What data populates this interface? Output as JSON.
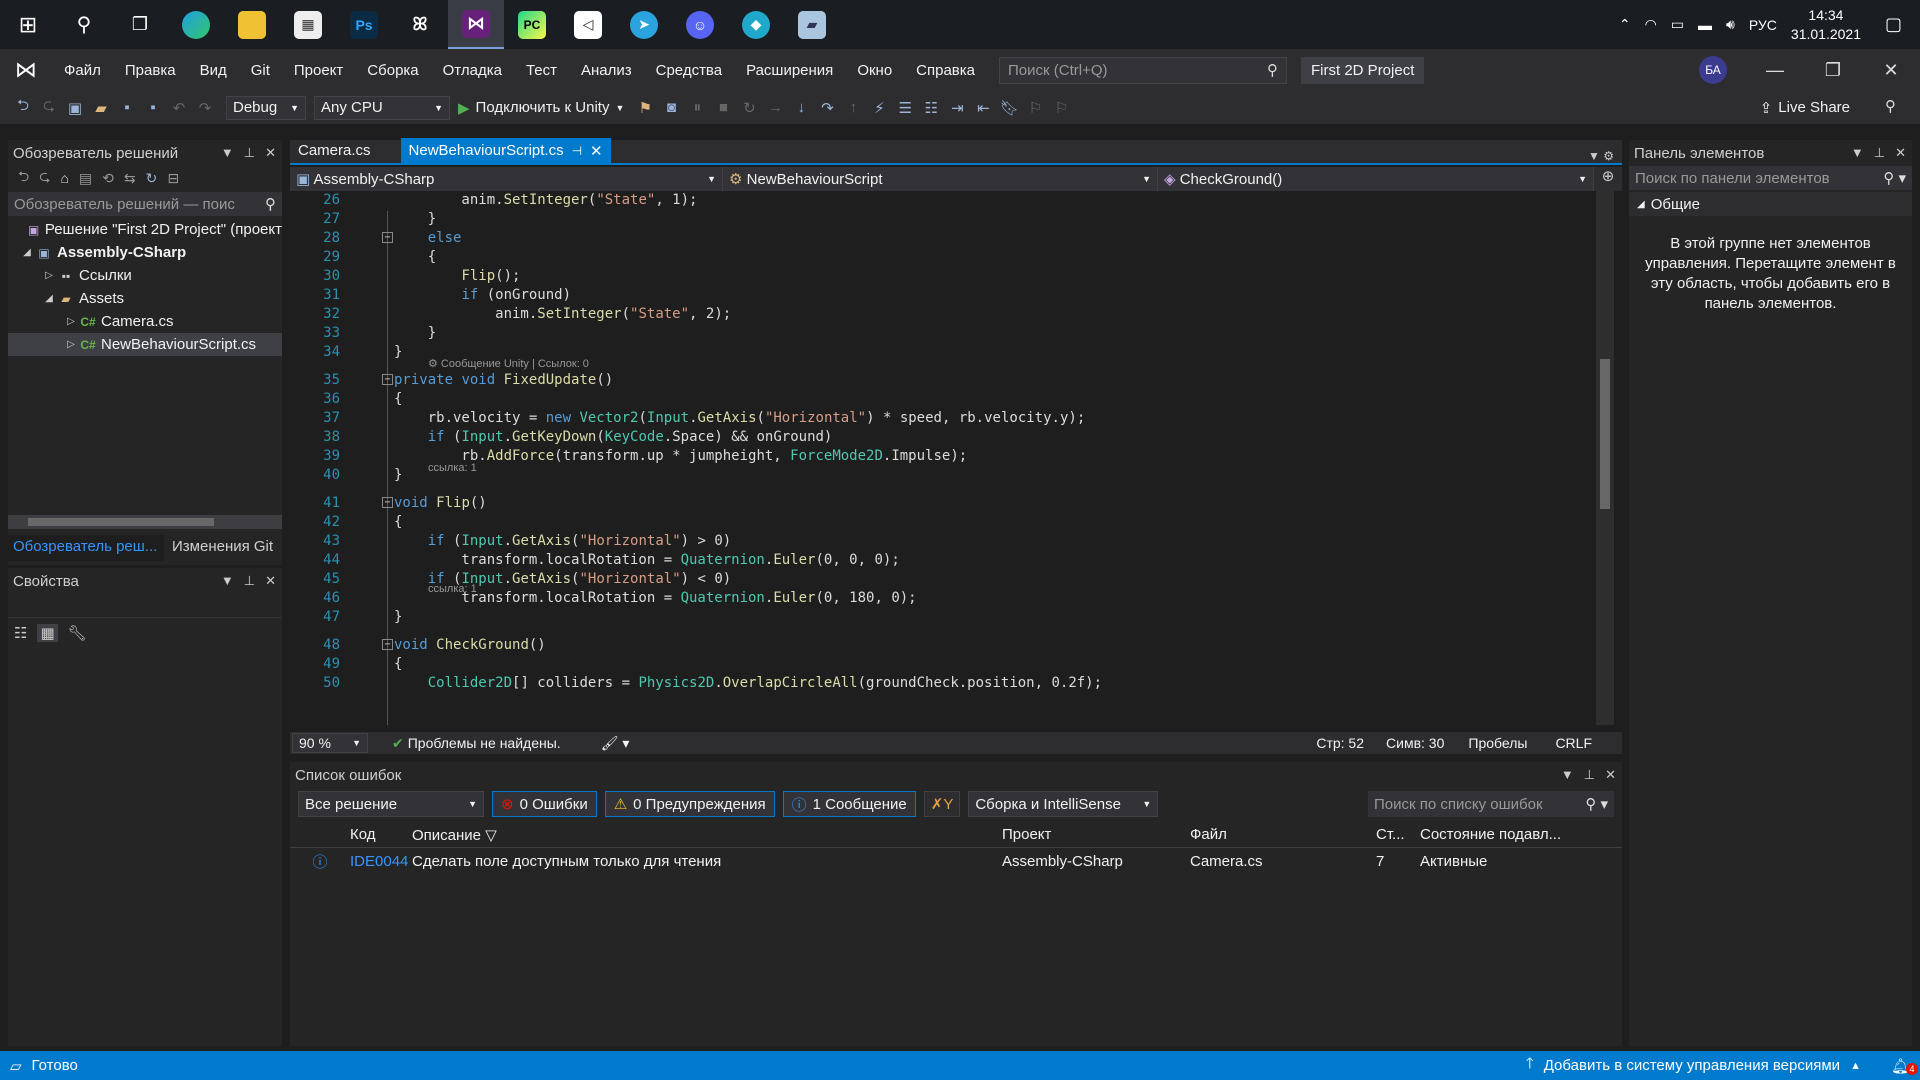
{
  "taskbar": {
    "icons": [
      "windows-start-icon",
      "search-icon",
      "task-view-icon",
      "edge-icon",
      "file-explorer-icon",
      "store-icon",
      "photoshop-icon",
      "unity-hub-icon",
      "visual-studio-icon",
      "pycharm-icon",
      "unity-icon",
      "telegram-icon",
      "discord-icon",
      "app-icon",
      "app2-icon"
    ],
    "ps_label": "Ps",
    "pc_label": "PC",
    "lang": "РУС",
    "time": "14:34",
    "date": "31.01.2021"
  },
  "menu": {
    "items": [
      "Файл",
      "Правка",
      "Вид",
      "Git",
      "Проект",
      "Сборка",
      "Отладка",
      "Тест",
      "Анализ",
      "Средства",
      "Расширения",
      "Окно",
      "Справка"
    ],
    "search_placeholder": "Поиск (Ctrl+Q)",
    "project_name": "First 2D Project",
    "avatar": "БА"
  },
  "toolbar": {
    "config": "Debug",
    "platform": "Any CPU",
    "run_label": "Подключить к Unity",
    "live_share": "Live Share"
  },
  "solution": {
    "title": "Обозреватель решений",
    "search_placeholder": "Обозреватель решений — поис",
    "items": [
      "Решение \"First 2D Project\" (проект",
      "Assembly-CSharp",
      "Ссылки",
      "Assets",
      "Camera.cs",
      "NewBehaviourScript.cs"
    ],
    "tabs": [
      "Обозреватель реш...",
      "Изменения Git"
    ]
  },
  "properties": {
    "title": "Свойства"
  },
  "toolbox": {
    "title": "Панель элементов",
    "search_placeholder": "Поиск по панели элементов",
    "group": "Общие",
    "empty_text": "В этой группе нет элементов управления. Перетащите элемент в эту область, чтобы добавить его в панель элементов."
  },
  "editor": {
    "tabs": [
      "Camera.cs",
      "NewBehaviourScript.cs"
    ],
    "nav": [
      "Assembly-CSharp",
      "NewBehaviourScript",
      "CheckGround()"
    ],
    "lens": [
      "Сообщение Unity | Ссылок: 0",
      "ссылка: 1",
      "ссылка: 1"
    ],
    "zoom": "90 %",
    "problems": "Проблемы не найдены.",
    "line": "Стр: 52",
    "col": "Симв: 30",
    "spaces": "Пробелы",
    "eol": "CRLF",
    "lines": [
      {
        "n": "26",
        "code": "        anim.SetInteger(\"State\", 1);"
      },
      {
        "n": "27",
        "code": "    }"
      },
      {
        "n": "28",
        "code": "    else"
      },
      {
        "n": "29",
        "code": "    {"
      },
      {
        "n": "30",
        "code": "        Flip();"
      },
      {
        "n": "31",
        "code": "        if (onGround)"
      },
      {
        "n": "32",
        "code": "            anim.SetInteger(\"State\", 2);"
      },
      {
        "n": "33",
        "code": "    }"
      },
      {
        "n": "34",
        "code": "}"
      },
      {
        "n": "35",
        "code": "private void FixedUpdate()"
      },
      {
        "n": "36",
        "code": "{"
      },
      {
        "n": "37",
        "code": "    rb.velocity = new Vector2(Input.GetAxis(\"Horizontal\") * speed, rb.velocity.y);"
      },
      {
        "n": "38",
        "code": "    if (Input.GetKeyDown(KeyCode.Space) && onGround)"
      },
      {
        "n": "39",
        "code": "        rb.AddForce(transform.up * jumpheight, ForceMode2D.Impulse);"
      },
      {
        "n": "40",
        "code": "}"
      },
      {
        "n": "41",
        "code": "void Flip()"
      },
      {
        "n": "42",
        "code": "{"
      },
      {
        "n": "43",
        "code": "    if (Input.GetAxis(\"Horizontal\") > 0)"
      },
      {
        "n": "44",
        "code": "        transform.localRotation = Quaternion.Euler(0, 0, 0);"
      },
      {
        "n": "45",
        "code": "    if (Input.GetAxis(\"Horizontal\") < 0)"
      },
      {
        "n": "46",
        "code": "        transform.localRotation = Quaternion.Euler(0, 180, 0);"
      },
      {
        "n": "47",
        "code": "}"
      },
      {
        "n": "48",
        "code": "void CheckGround()"
      },
      {
        "n": "49",
        "code": "{"
      },
      {
        "n": "50",
        "code": "    Collider2D[] colliders = Physics2D.OverlapCircleAll(groundCheck.position, 0.2f);"
      }
    ]
  },
  "errors": {
    "title": "Список ошибок",
    "scope": "Все решение",
    "errors_btn": "0 Ошибки",
    "warnings_btn": "0 Предупреждения",
    "messages_btn": "1 Сообщение",
    "source": "Сборка и IntelliSense",
    "search_placeholder": "Поиск по списку ошибок",
    "columns": [
      "Код",
      "Описание",
      "Проект",
      "Файл",
      "Ст...",
      "Состояние подавл..."
    ],
    "row": {
      "code": "IDE0044",
      "desc": "Сделать поле доступным только для чтения",
      "project": "Assembly-CSharp",
      "file": "Camera.cs",
      "line": "7",
      "state": "Активные"
    }
  },
  "status": {
    "ready": "Готово",
    "vcs": "Добавить в систему управления версиями",
    "notif": "4"
  }
}
